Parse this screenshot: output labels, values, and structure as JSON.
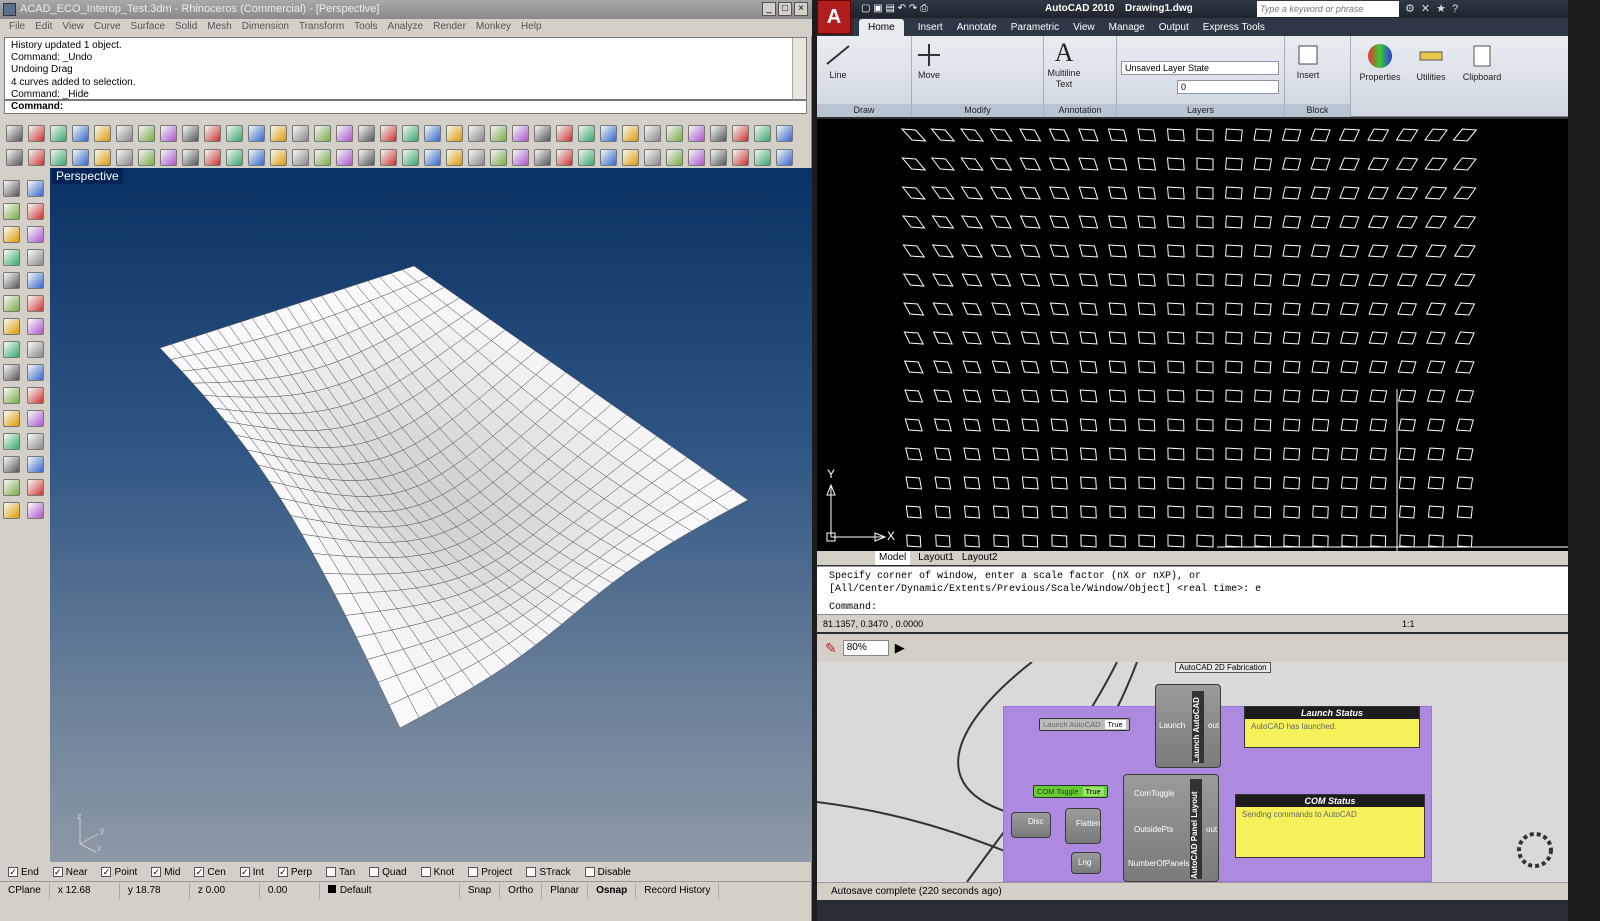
{
  "rhino": {
    "title": "ACAD_ECO_Interop_Test.3dm - Rhinoceros (Commercial) - [Perspective]",
    "menu": [
      "File",
      "Edit",
      "View",
      "Curve",
      "Surface",
      "Solid",
      "Mesh",
      "Dimension",
      "Transform",
      "Tools",
      "Analyze",
      "Render",
      "Monkey",
      "Help"
    ],
    "history": [
      "History updated 1 object.",
      "Command: _Undo",
      "Undoing Drag",
      "4 curves added to selection.",
      "Command: _Hide"
    ],
    "command_label": "Command:",
    "viewport_label": "Perspective",
    "axes": {
      "z": "z",
      "y": "y",
      "x": "x"
    },
    "osnaps": [
      {
        "label": "End",
        "checked": true
      },
      {
        "label": "Near",
        "checked": true
      },
      {
        "label": "Point",
        "checked": true
      },
      {
        "label": "Mid",
        "checked": true
      },
      {
        "label": "Cen",
        "checked": true
      },
      {
        "label": "Int",
        "checked": true
      },
      {
        "label": "Perp",
        "checked": true
      },
      {
        "label": "Tan",
        "checked": false
      },
      {
        "label": "Quad",
        "checked": false
      },
      {
        "label": "Knot",
        "checked": false
      },
      {
        "label": "Project",
        "checked": false
      },
      {
        "label": "STrack",
        "checked": false
      },
      {
        "label": "Disable",
        "checked": false
      }
    ],
    "status": {
      "cplane": "CPlane",
      "x": "x 12.68",
      "y": "y 18.78",
      "z": "z 0.00",
      "dist": "0.00",
      "layer": "Default",
      "snap": "Snap",
      "ortho": "Ortho",
      "planar": "Planar",
      "osnap": "Osnap",
      "history": "Record History"
    }
  },
  "acad": {
    "title": "AutoCAD 2010",
    "drawing": "Drawing1.dwg",
    "search_placeholder": "Type a keyword or phrase",
    "tabs": [
      "Home",
      "Insert",
      "Annotate",
      "Parametric",
      "View",
      "Manage",
      "Output",
      "Express Tools"
    ],
    "panels": {
      "draw": "Draw",
      "modify": "Modify",
      "annotation": "Annotation",
      "layers": "Layers",
      "block": "Block"
    },
    "buttons": {
      "line": "Line",
      "move": "Move",
      "mtext": "Multiline Text",
      "insert": "Insert",
      "properties": "Properties",
      "utilities": "Utilities",
      "clipboard": "Clipboard"
    },
    "layer_state": "Unsaved Layer State",
    "layer_name": "0",
    "ucs": {
      "x": "X",
      "y": "Y"
    },
    "layout_tabs": [
      "Model",
      "Layout1",
      "Layout2"
    ],
    "cmd_lines": [
      "Specify corner of window, enter a scale factor (nX or nXP), or",
      "[All/Center/Dynamic/Extents/Previous/Scale/Window/Object] <real time>: e"
    ],
    "cmd_prompt": "Command:",
    "coords": "81.1357, 0.3470 , 0.0000",
    "scale": "1:1"
  },
  "gh": {
    "zoom": "80%",
    "group_label": "AutoCAD 2D Fabrication",
    "launch_toggle": "Launch AutoCAD",
    "launch_value": "True",
    "launch_input": "Launch",
    "launch_out": "out",
    "launch_comp": "Launch AutoCAD",
    "launch_status_title": "Launch Status",
    "launch_status_text": "AutoCAD has launched.",
    "com_toggle": "COM Toggle",
    "com_value": "True",
    "panel_inputs": [
      "ComToggle",
      "OutsidePts",
      "NumberOfPanels"
    ],
    "panel_comp": "AutoCAD Panel Layout",
    "panel_out": "out",
    "com_status_title": "COM Status",
    "com_status_text": "Sending commands to AutoCAD",
    "disc": "Disc",
    "flatten": "Flatten",
    "lng": "Lng",
    "footer": "Autosave complete (220 seconds ago)"
  }
}
